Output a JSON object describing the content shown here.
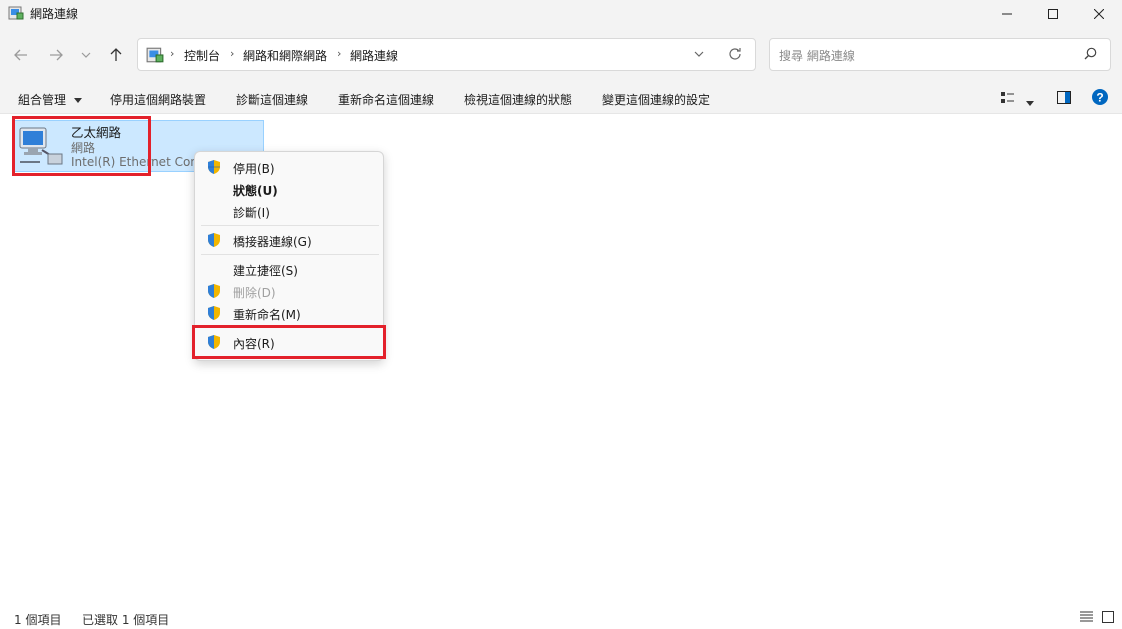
{
  "window": {
    "title": "網路連線"
  },
  "nav": {
    "breadcrumbs": [
      "控制台",
      "網路和網際網路",
      "網路連線"
    ],
    "search_placeholder": "搜尋 網路連線"
  },
  "commands": {
    "organize": "組合管理",
    "disable": "停用這個網路裝置",
    "diagnose": "診斷這個連線",
    "rename": "重新命名這個連線",
    "view_status": "檢視這個連線的狀態",
    "change_settings": "變更這個連線的設定"
  },
  "item": {
    "name": "乙太網路",
    "network": "網路",
    "device": "Intel(R) Ethernet Conne"
  },
  "context_menu": {
    "disable": "停用(B)",
    "status": "狀態(U)",
    "diagnose": "診斷(I)",
    "bridge": "橋接器連線(G)",
    "shortcut": "建立捷徑(S)",
    "delete": "刪除(D)",
    "rename": "重新命名(M)",
    "properties": "內容(R)"
  },
  "status": {
    "count": "1 個項目",
    "selected": "已選取 1 個項目"
  },
  "colors": {
    "highlight": "#e3212b",
    "selection": "#cce8ff",
    "help": "#0067c0"
  }
}
